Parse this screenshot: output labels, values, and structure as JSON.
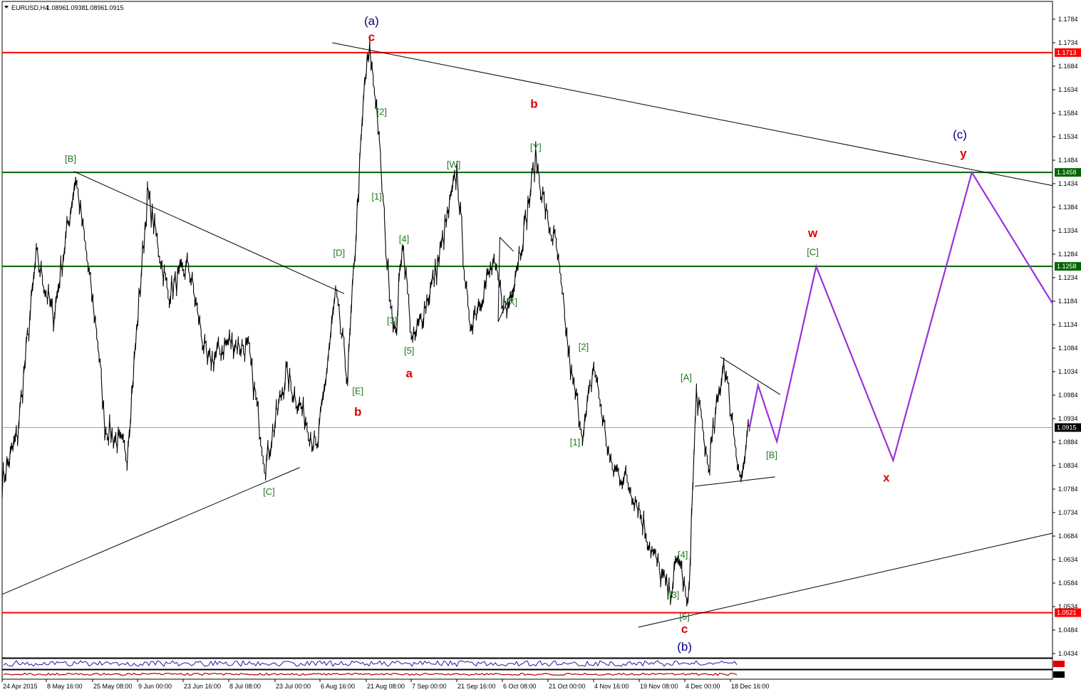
{
  "window": {
    "symbol_label": "EURUSD,H4",
    "ohlc": [
      "1.0896",
      "1.0938",
      "1.0896",
      "1.0915"
    ]
  },
  "colors": {
    "support_resistance": "#ff0000",
    "green_level": "#006400",
    "projection": "#9b30d9",
    "wave_green": "#1f7a1f",
    "wave_red": "#e00000",
    "wave_blue": "#000080",
    "current_price_tag": "#000000"
  },
  "chart_data": {
    "type": "candlestick",
    "price_axis": {
      "ticks": [
        "1.1784",
        "1.1734",
        "1.1684",
        "1.1634",
        "1.1584",
        "1.1534",
        "1.1484",
        "1.1434",
        "1.1384",
        "1.1334",
        "1.1284",
        "1.1234",
        "1.1184",
        "1.1134",
        "1.1084",
        "1.1034",
        "1.0984",
        "1.0934",
        "1.0884",
        "1.0834",
        "1.0784",
        "1.0734",
        "1.0684",
        "1.0634",
        "1.0584",
        "1.0534",
        "1.0484",
        "1.0434"
      ],
      "ylim": [
        1.0415,
        1.1835
      ]
    },
    "time_axis": {
      "labels": [
        "24 Apr 2015",
        "8 May 16:00",
        "25 May 08:00",
        "9 Jun 00:00",
        "23 Jun 16:00",
        "8 Jul 08:00",
        "23 Jul 00:00",
        "6 Aug 16:00",
        "21 Aug 08:00",
        "7 Sep 00:00",
        "21 Sep 16:00",
        "6 Oct 08:00",
        "21 Oct 00:00",
        "4 Nov 16:00",
        "19 Nov 08:00",
        "4 Dec 00:00",
        "18 Dec 16:00"
      ]
    },
    "horizontal_levels": [
      {
        "price": 1.1713,
        "label": "1.1713",
        "kind": "red"
      },
      {
        "price": 1.1458,
        "label": "1.1458",
        "kind": "green"
      },
      {
        "price": 1.1258,
        "label": "1.1258",
        "kind": "green"
      },
      {
        "price": 1.0521,
        "label": "1.0521",
        "kind": "red"
      }
    ],
    "current_price": {
      "price": 1.0915,
      "label": "1.0915"
    },
    "price_path": [
      [
        0.0,
        1.08
      ],
      [
        0.9,
        1.09
      ],
      [
        2.0,
        1.128
      ],
      [
        3.0,
        1.115
      ],
      [
        4.3,
        1.145
      ],
      [
        5.6,
        1.11
      ],
      [
        6.0,
        1.092
      ],
      [
        7.3,
        1.086
      ],
      [
        8.5,
        1.141
      ],
      [
        9.7,
        1.12
      ],
      [
        10.9,
        1.126
      ],
      [
        12.0,
        1.105
      ],
      [
        13.3,
        1.11
      ],
      [
        14.4,
        1.108
      ],
      [
        15.4,
        1.0835
      ],
      [
        16.6,
        1.103
      ],
      [
        17.9,
        1.092
      ],
      [
        18.4,
        1.086
      ],
      [
        19.5,
        1.12
      ],
      [
        20.2,
        1.102
      ],
      [
        21.2,
        1.165
      ],
      [
        21.5,
        1.1713
      ],
      [
        21.9,
        1.16
      ],
      [
        22.5,
        1.127
      ],
      [
        23.0,
        1.11
      ],
      [
        23.4,
        1.132
      ],
      [
        24.0,
        1.109
      ],
      [
        25.4,
        1.125
      ],
      [
        26.6,
        1.146
      ],
      [
        27.3,
        1.113
      ],
      [
        28.7,
        1.126
      ],
      [
        29.5,
        1.116
      ],
      [
        30.6,
        1.135
      ],
      [
        31.2,
        1.149
      ],
      [
        31.9,
        1.135
      ],
      [
        32.4,
        1.13
      ],
      [
        33.3,
        1.102
      ],
      [
        34.0,
        1.09
      ],
      [
        34.6,
        1.105
      ],
      [
        35.6,
        1.083
      ],
      [
        36.4,
        1.081
      ],
      [
        37.1,
        1.076
      ],
      [
        38.0,
        1.065
      ],
      [
        39.0,
        1.056
      ],
      [
        39.6,
        1.064
      ],
      [
        40.1,
        1.0521
      ],
      [
        40.6,
        1.099
      ],
      [
        41.3,
        1.083
      ],
      [
        42.2,
        1.106
      ],
      [
        43.2,
        1.08
      ],
      [
        43.7,
        1.0915
      ]
    ],
    "projection_path": [
      [
        43.7,
        1.0915
      ],
      [
        44.2,
        1.1005
      ],
      [
        45.3,
        1.0885
      ],
      [
        47.6,
        1.1258
      ],
      [
        52.1,
        1.0845
      ],
      [
        56.7,
        1.1458
      ],
      [
        61.4,
        1.118
      ]
    ],
    "trendlines": [
      {
        "from": [
          19.3,
          1.1734
        ],
        "to": [
          61.4,
          1.143
        ]
      },
      {
        "from": [
          4.2,
          1.146
        ],
        "to": [
          20.0,
          1.12
        ]
      },
      {
        "from": [
          0.0,
          1.056
        ],
        "to": [
          17.4,
          1.083
        ]
      },
      {
        "from": [
          37.2,
          1.049
        ],
        "to": [
          61.4,
          1.069
        ]
      },
      {
        "from": [
          42.0,
          1.1065
        ],
        "to": [
          45.5,
          1.0985
        ]
      },
      {
        "from": [
          40.5,
          1.079
        ],
        "to": [
          45.2,
          1.081
        ]
      },
      {
        "from": [
          29.1,
          1.132
        ],
        "to": [
          29.9,
          1.129
        ]
      },
      {
        "from": [
          29.1,
          1.132
        ],
        "to": [
          29.0,
          1.114
        ]
      },
      {
        "from": [
          29.0,
          1.114
        ],
        "to": [
          30.0,
          1.122
        ]
      }
    ],
    "wave_labels": [
      {
        "text": "(a)",
        "at": [
          21.6,
          1.1772
        ],
        "style": "blue"
      },
      {
        "text": "c",
        "at": [
          21.6,
          1.1738
        ],
        "style": "red"
      },
      {
        "text": "[2]",
        "at": [
          22.2,
          1.158
        ],
        "style": "green"
      },
      {
        "text": "[1]",
        "at": [
          21.9,
          1.14
        ],
        "style": "green"
      },
      {
        "text": "[B]",
        "at": [
          4.0,
          1.148
        ],
        "style": "green"
      },
      {
        "text": "[W]",
        "at": [
          26.4,
          1.1468
        ],
        "style": "green"
      },
      {
        "text": "[Y]",
        "at": [
          31.2,
          1.1505
        ],
        "style": "green"
      },
      {
        "text": "b",
        "at": [
          31.1,
          1.1595
        ],
        "style": "red"
      },
      {
        "text": "[4]",
        "at": [
          23.5,
          1.131
        ],
        "style": "green"
      },
      {
        "text": "[D]",
        "at": [
          19.7,
          1.128
        ],
        "style": "green"
      },
      {
        "text": "[3]",
        "at": [
          22.8,
          1.1136
        ],
        "style": "green"
      },
      {
        "text": "[5]",
        "at": [
          23.8,
          1.1072
        ],
        "style": "green"
      },
      {
        "text": "a",
        "at": [
          23.8,
          1.1022
        ],
        "style": "red"
      },
      {
        "text": "[X]",
        "at": [
          29.8,
          1.1176
        ],
        "style": "green"
      },
      {
        "text": "[E]",
        "at": [
          20.8,
          1.0986
        ],
        "style": "green"
      },
      {
        "text": "b",
        "at": [
          20.8,
          1.094
        ],
        "style": "red"
      },
      {
        "text": "[C]",
        "at": [
          15.6,
          1.0772
        ],
        "style": "green"
      },
      {
        "text": "[2]",
        "at": [
          34.0,
          1.108
        ],
        "style": "green"
      },
      {
        "text": "[1]",
        "at": [
          33.5,
          1.0877
        ],
        "style": "green"
      },
      {
        "text": "[A]",
        "at": [
          40.0,
          1.1015
        ],
        "style": "green"
      },
      {
        "text": "[4]",
        "at": [
          39.8,
          1.0638
        ],
        "style": "green"
      },
      {
        "text": "[3]",
        "at": [
          39.3,
          1.0552
        ],
        "style": "green"
      },
      {
        "text": "[5]",
        "at": [
          39.9,
          1.0506
        ],
        "style": "green"
      },
      {
        "text": "c",
        "at": [
          39.9,
          1.0478
        ],
        "style": "red"
      },
      {
        "text": "(b)",
        "at": [
          39.9,
          1.044
        ],
        "style": "blue"
      },
      {
        "text": "w",
        "at": [
          47.4,
          1.132
        ],
        "style": "red"
      },
      {
        "text": "[C]",
        "at": [
          47.4,
          1.1282
        ],
        "style": "green"
      },
      {
        "text": "[B]",
        "at": [
          45.0,
          1.085
        ],
        "style": "green"
      },
      {
        "text": "x",
        "at": [
          51.7,
          1.08
        ],
        "style": "red"
      },
      {
        "text": "(c)",
        "at": [
          56.0,
          1.153
        ],
        "style": "blue"
      },
      {
        "text": "y",
        "at": [
          56.2,
          1.149
        ],
        "style": "red"
      }
    ]
  }
}
